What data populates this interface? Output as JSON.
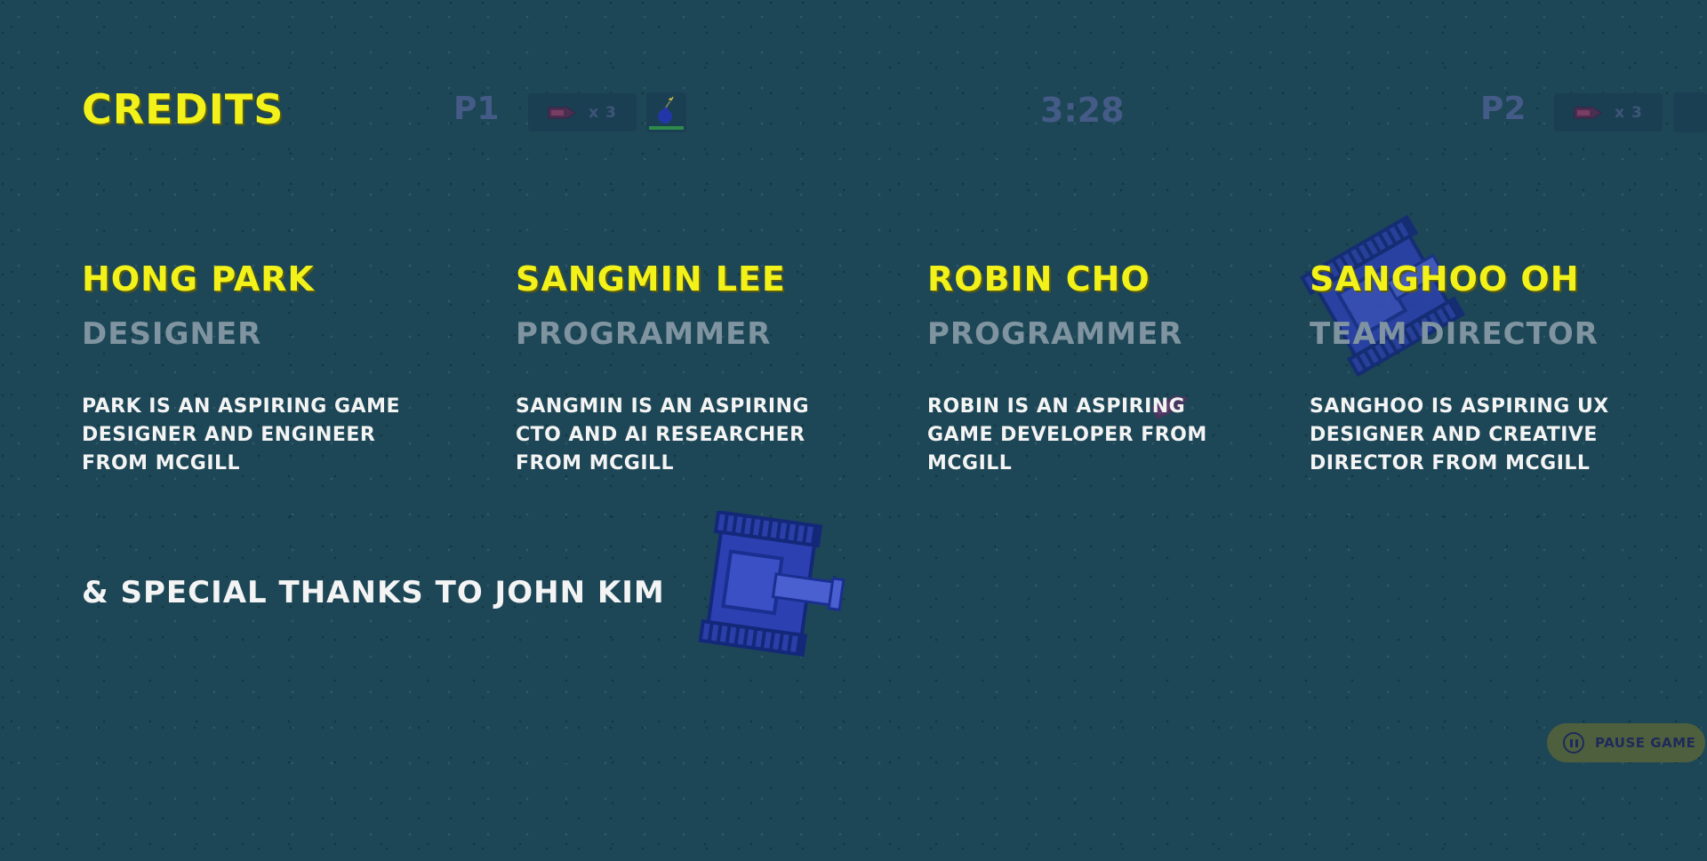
{
  "page": {
    "title": "CREDITS"
  },
  "hud": {
    "p1": {
      "label": "P1",
      "ammo": "x 3",
      "ammo_icon": "shell-icon",
      "special_icon": "bomb-icon"
    },
    "timer": "3:28",
    "p2": {
      "label": "P2",
      "ammo": "x 3",
      "ammo_icon": "shell-icon"
    }
  },
  "credits": [
    {
      "name": "HONG PARK",
      "role": "DESIGNER",
      "bio": "PARK IS AN ASPIRING GAME DESIGNER AND ENGINEER FROM MCGILL"
    },
    {
      "name": "SANGMIN LEE",
      "role": "PROGRAMMER",
      "bio": "SANGMIN IS AN ASPIRING CTO AND AI RESEARCHER FROM MCGILL"
    },
    {
      "name": "ROBIN CHO",
      "role": "PROGRAMMER",
      "bio": "ROBIN IS AN ASPIRING GAME DEVELOPER FROM MCGILL"
    },
    {
      "name": "SANGHOO OH",
      "role": "TEAM DIRECTOR",
      "bio": "SANGHOO IS ASPIRING UX DESIGNER AND CREATIVE DIRECTOR FROM MCGILL"
    }
  ],
  "special_thanks": "& SPECIAL THANKS TO JOHN KIM",
  "controls": {
    "pause_label": "PAUSE GAME",
    "pause_icon": "pause-icon"
  },
  "colors": {
    "background": "#1d4756",
    "heading_yellow": "#f2f21a",
    "role_gray": "#7f94a0",
    "body_white": "#f4f4f4",
    "tank_blue": "#2a3fb0",
    "pause_bg": "#4e5f3e"
  }
}
